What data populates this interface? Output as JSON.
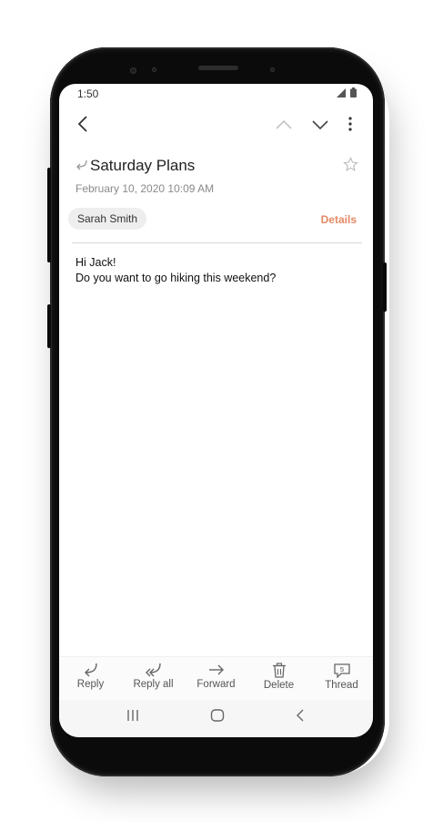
{
  "status_bar": {
    "time": "1:50"
  },
  "email": {
    "subject": "Saturday Plans",
    "date": "February 10, 2020  10:09 AM",
    "sender": "Sarah Smith",
    "details_label": "Details",
    "body_lines": [
      "Hi Jack!",
      "Do you want to go hiking this weekend?"
    ]
  },
  "actions": [
    {
      "label": "Reply",
      "icon": "reply-icon"
    },
    {
      "label": "Reply all",
      "icon": "reply-all-icon"
    },
    {
      "label": "Forward",
      "icon": "forward-icon"
    },
    {
      "label": "Delete",
      "icon": "trash-icon"
    },
    {
      "label": "Thread",
      "icon": "thread-icon",
      "badge": "5"
    }
  ],
  "colors": {
    "accent": "#e68a66",
    "text": "#222222",
    "muted": "#8a8a8a"
  }
}
